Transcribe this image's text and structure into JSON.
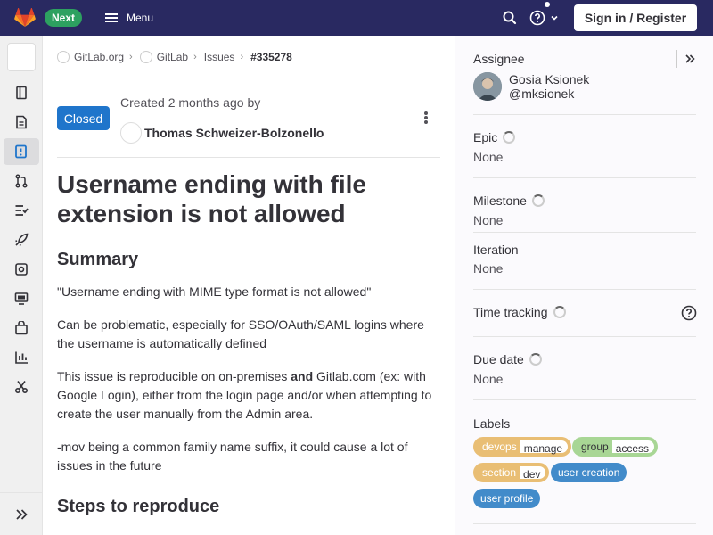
{
  "topbar": {
    "next_badge": "Next",
    "menu_label": "Menu",
    "signin_label": "Sign in / Register",
    "icons": [
      "gitlab-logo-icon",
      "hamburger-icon",
      "search-icon",
      "help-icon",
      "chevron-down-icon"
    ]
  },
  "leftnav": {
    "icons": [
      "project-avatar",
      "project-overview-icon",
      "repository-icon",
      "issues-icon",
      "merge-requests-icon",
      "ci-cd-icon",
      "deployments-icon",
      "monitor-icon",
      "infrastructure-icon",
      "packages-icon",
      "analytics-icon",
      "snippets-icon",
      "collapse-sidebar-icon"
    ],
    "active": "issues-icon"
  },
  "breadcrumb": {
    "items": [
      "GitLab.org",
      "GitLab",
      "Issues",
      "#335278"
    ]
  },
  "issue": {
    "status": "Closed",
    "created_prefix": "Created",
    "created_time": "2 months ago",
    "created_by": "by",
    "author": "Thomas Schweizer-Bolzonello",
    "title": "Username ending with file extension is not allowed",
    "summary_heading": "Summary",
    "para1": "\"Username ending with MIME type format is not allowed\"",
    "para2": "Can be problematic, especially for SSO/OAuth/SAML logins where the username is automatically defined",
    "para3_a": "This issue is reproducible on on-premises ",
    "para3_bold": "and",
    "para3_b": " Gitlab.com (ex: with Google Login), either from the login page and/or when attempting to create the user manually from the Admin area.",
    "para4": "-mov being a common family name suffix, it could cause a lot of issues in the future",
    "steps_heading": "Steps to reproduce"
  },
  "sidebar": {
    "assignee_label": "Assignee",
    "assignee_name": "Gosia Ksionek",
    "assignee_username": "@mksionek",
    "epic_label": "Epic",
    "epic_value": "None",
    "milestone_label": "Milestone",
    "milestone_value": "None",
    "iteration_label": "Iteration",
    "iteration_value": "None",
    "time_tracking_label": "Time tracking",
    "due_date_label": "Due date",
    "due_date_value": "None",
    "labels_label": "Labels",
    "labels": [
      {
        "key": "devops",
        "value": "manage",
        "color": "#e9be74"
      },
      {
        "key": "group",
        "value": "access",
        "color": "#a8d695"
      },
      {
        "key": "section",
        "value": "dev",
        "color": "#e9be74"
      },
      {
        "key": "user creation",
        "value": "",
        "color": "#428bca"
      },
      {
        "key": "user profile",
        "value": "",
        "color": "#428bca"
      }
    ]
  },
  "colors": {
    "topbar": "#292961",
    "next_badge": "#2da160",
    "closed_badge": "#1f75cb"
  }
}
